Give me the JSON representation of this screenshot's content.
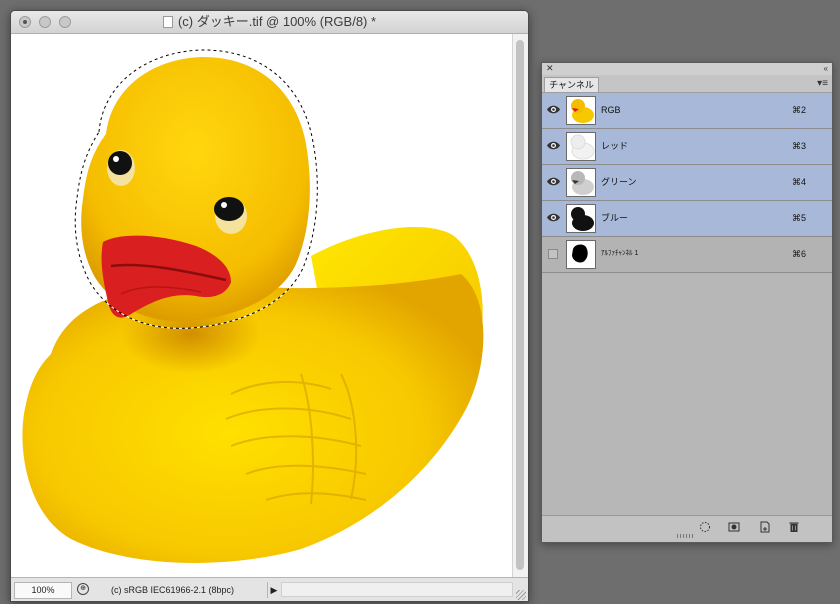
{
  "document_window": {
    "title": "(c) ダッキー.tif @ 100% (RGB/8) *",
    "icons": [
      "close-icon",
      "minimize-icon",
      "zoom-icon",
      "document-icon"
    ],
    "status_bar": {
      "zoom": "100%",
      "profile": "(c) sRGB IEC61966-2.1 (8bpc)"
    }
  },
  "channels_panel": {
    "tab_label": "チャンネル",
    "channels": [
      {
        "name": "RGB",
        "shortcut": "⌘2",
        "visible": true,
        "selected": true
      },
      {
        "name": "レッド",
        "shortcut": "⌘3",
        "visible": true,
        "selected": true
      },
      {
        "name": "グリーン",
        "shortcut": "⌘4",
        "visible": true,
        "selected": true
      },
      {
        "name": "ブルー",
        "shortcut": "⌘5",
        "visible": true,
        "selected": true
      },
      {
        "name": "ｱﾙﾌｧﾁｬﾝﾈﾙ 1",
        "shortcut": "⌘6",
        "visible": false,
        "selected": false
      }
    ],
    "footer_icons": [
      "load-selection-icon",
      "save-selection-icon",
      "new-channel-icon",
      "trash-icon"
    ]
  },
  "colors": {
    "duck_yellow": "#f7c800",
    "beak_red": "#d91f1f",
    "selection_highlight": "#a8b8d8",
    "panel_bg": "#b7b7b7",
    "desktop_bg": "#6e6e6e"
  }
}
